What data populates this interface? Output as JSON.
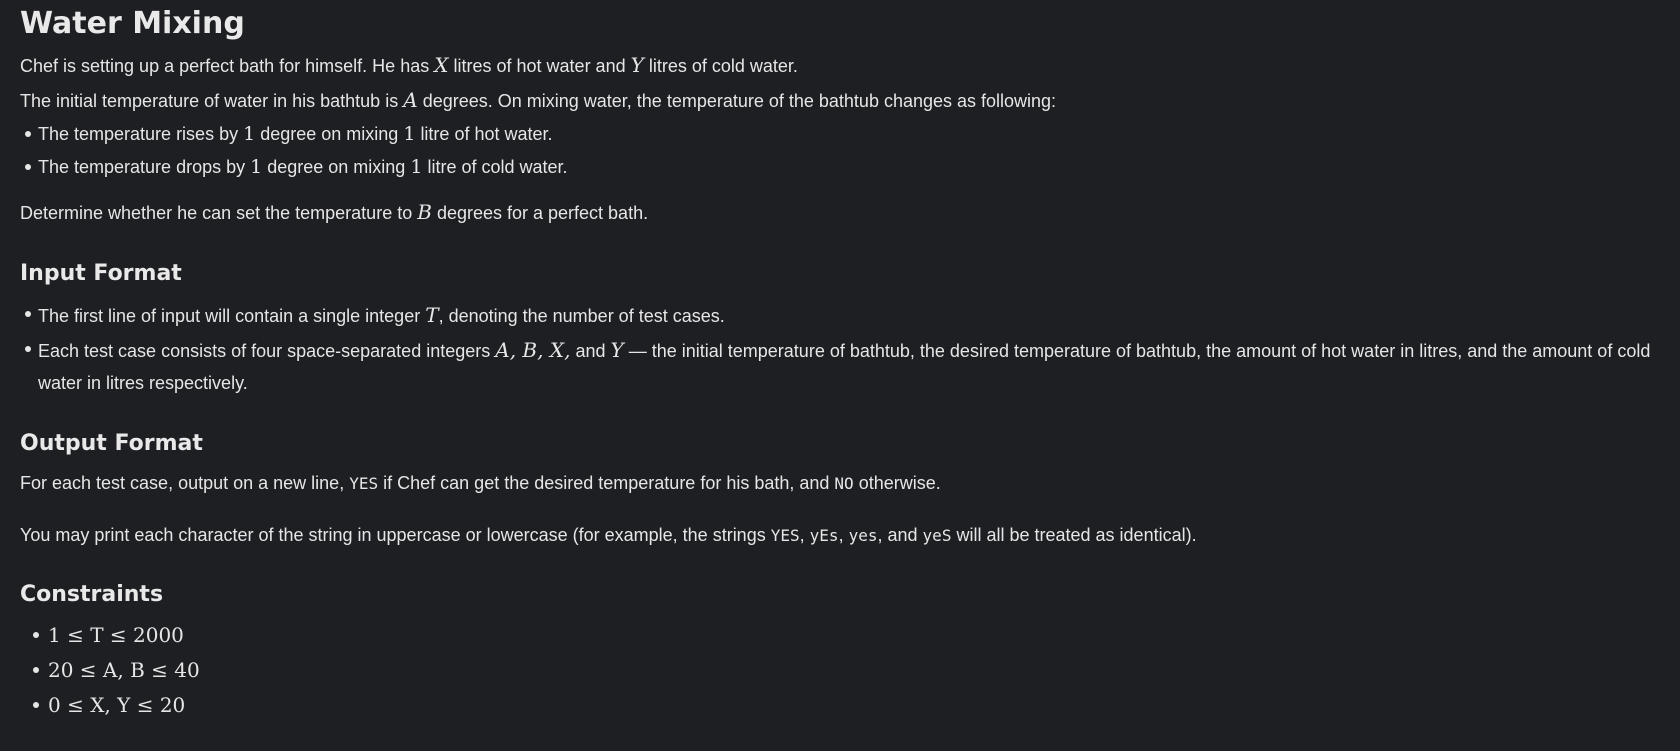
{
  "title": "Water Mixing",
  "statement": {
    "line1_pre": "Chef is setting up a perfect bath for himself. He has",
    "line1_X": "X",
    "line1_mid": "litres of hot water and",
    "line1_Y": "Y",
    "line1_post": "litres of cold water.",
    "line2_pre": "The initial temperature of water in his bathtub is",
    "line2_A": "A",
    "line2_post": "degrees. On mixing water, the temperature of the bathtub changes as following:",
    "bullet1_pre": "The temperature rises by",
    "bullet1_n1": "1",
    "bullet1_mid": "degree on mixing",
    "bullet1_n2": "1",
    "bullet1_post": "litre of hot water.",
    "bullet2_pre": "The temperature drops by",
    "bullet2_n1": "1",
    "bullet2_mid": "degree on mixing",
    "bullet2_n2": "1",
    "bullet2_post": "litre of cold water.",
    "determine_pre": "Determine whether he can set the temperature to",
    "determine_B": "B",
    "determine_post": "degrees for a perfect bath."
  },
  "input_format": {
    "heading": "Input Format",
    "b1_pre": "The first line of input will contain a single integer",
    "b1_T": "T",
    "b1_post": ", denoting the number of test cases.",
    "b2_pre": "Each test case consists of four space-separated integers",
    "b2_vars": "A, B, X,",
    "b2_and": "and",
    "b2_Y": "Y",
    "b2_post": "— the initial temperature of bathtub, the desired temperature of bathtub, the amount of hot water in litres, and the amount of cold water in litres respectively."
  },
  "output_format": {
    "heading": "Output Format",
    "p1_pre": "For each test case, output on a new line,",
    "p1_yes": "YES",
    "p1_mid": "if Chef can get the desired temperature for his bath, and",
    "p1_no": "NO",
    "p1_post": "otherwise.",
    "p2_pre": "You may print each character of the string in uppercase or lowercase (for example, the strings",
    "p2_s1": "YES",
    "p2_s2": "yEs",
    "p2_s3": "yes",
    "p2_and": ", and",
    "p2_s4": "yeS",
    "p2_post": "will all be treated as identical)."
  },
  "constraints": {
    "heading": "Constraints",
    "items": [
      "1 ≤ T ≤ 2000",
      "20 ≤ A, B ≤ 40",
      "0 ≤ X, Y ≤ 20"
    ]
  }
}
